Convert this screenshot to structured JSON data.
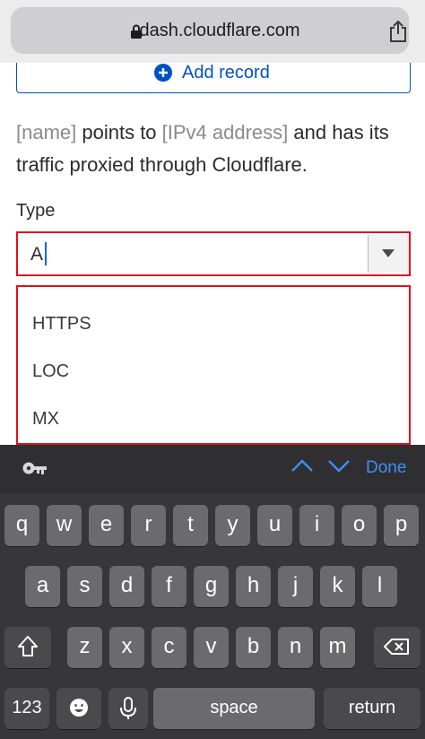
{
  "browser": {
    "url": "dash.cloudflare.com",
    "lock_icon": "lock-icon",
    "share_icon": "share-icon"
  },
  "page": {
    "add_record_label": "Add record",
    "description": {
      "part1": "[name]",
      "part2": " points to ",
      "part3": "[IPv4 address]",
      "part4": " and has its traffic proxied through Cloudflare."
    },
    "type_label": "Type",
    "select_value": "A",
    "options": [
      "HTTPS",
      "LOC",
      "MX"
    ]
  },
  "accessory_bar": {
    "done_label": "Done"
  },
  "keyboard": {
    "row1": [
      "q",
      "w",
      "e",
      "r",
      "t",
      "y",
      "u",
      "i",
      "o",
      "p"
    ],
    "row2": [
      "a",
      "s",
      "d",
      "f",
      "g",
      "h",
      "j",
      "k",
      "l"
    ],
    "row3": [
      "z",
      "x",
      "c",
      "v",
      "b",
      "n",
      "m"
    ],
    "numbers_label": "123",
    "space_label": "space",
    "return_label": "return"
  },
  "colors": {
    "accent_blue": "#0051c3",
    "highlight_red": "#e0101a",
    "keyboard_bg": "#373739",
    "key_bg": "#6b6b6e"
  }
}
